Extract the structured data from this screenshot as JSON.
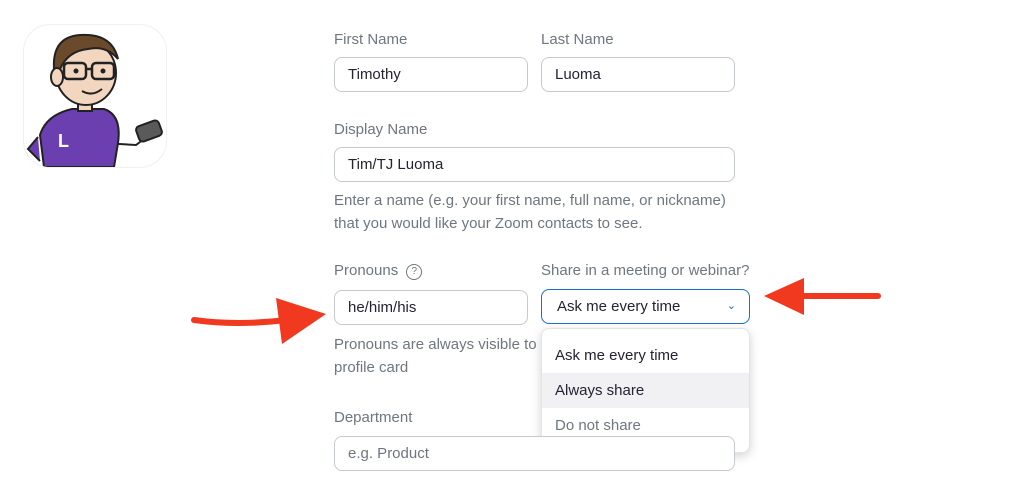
{
  "first_name": {
    "label": "First Name",
    "value": "Timothy"
  },
  "last_name": {
    "label": "Last Name",
    "value": "Luoma"
  },
  "display_name": {
    "label": "Display Name",
    "value": "Tim/TJ Luoma",
    "help_line1": "Enter a name (e.g. your first name, full name, or nickname)",
    "help_line2": "that you would like your Zoom contacts to see."
  },
  "pronouns": {
    "label": "Pronouns",
    "info_icon": "?",
    "value": "he/him/his",
    "help_line1": "Pronouns are always visible to",
    "help_line2": "profile card"
  },
  "share": {
    "label": "Share in a meeting or webinar?",
    "selected": "Ask me every time",
    "chevron": "⌄",
    "options": [
      "Ask me every time",
      "Always share",
      "Do not share"
    ]
  },
  "department": {
    "label": "Department",
    "placeholder": "e.g. Product"
  },
  "colors": {
    "accent": "#1d6bd6",
    "annotation_arrow": "#f0391f",
    "avatar_shirt": "#6b3fb0"
  }
}
